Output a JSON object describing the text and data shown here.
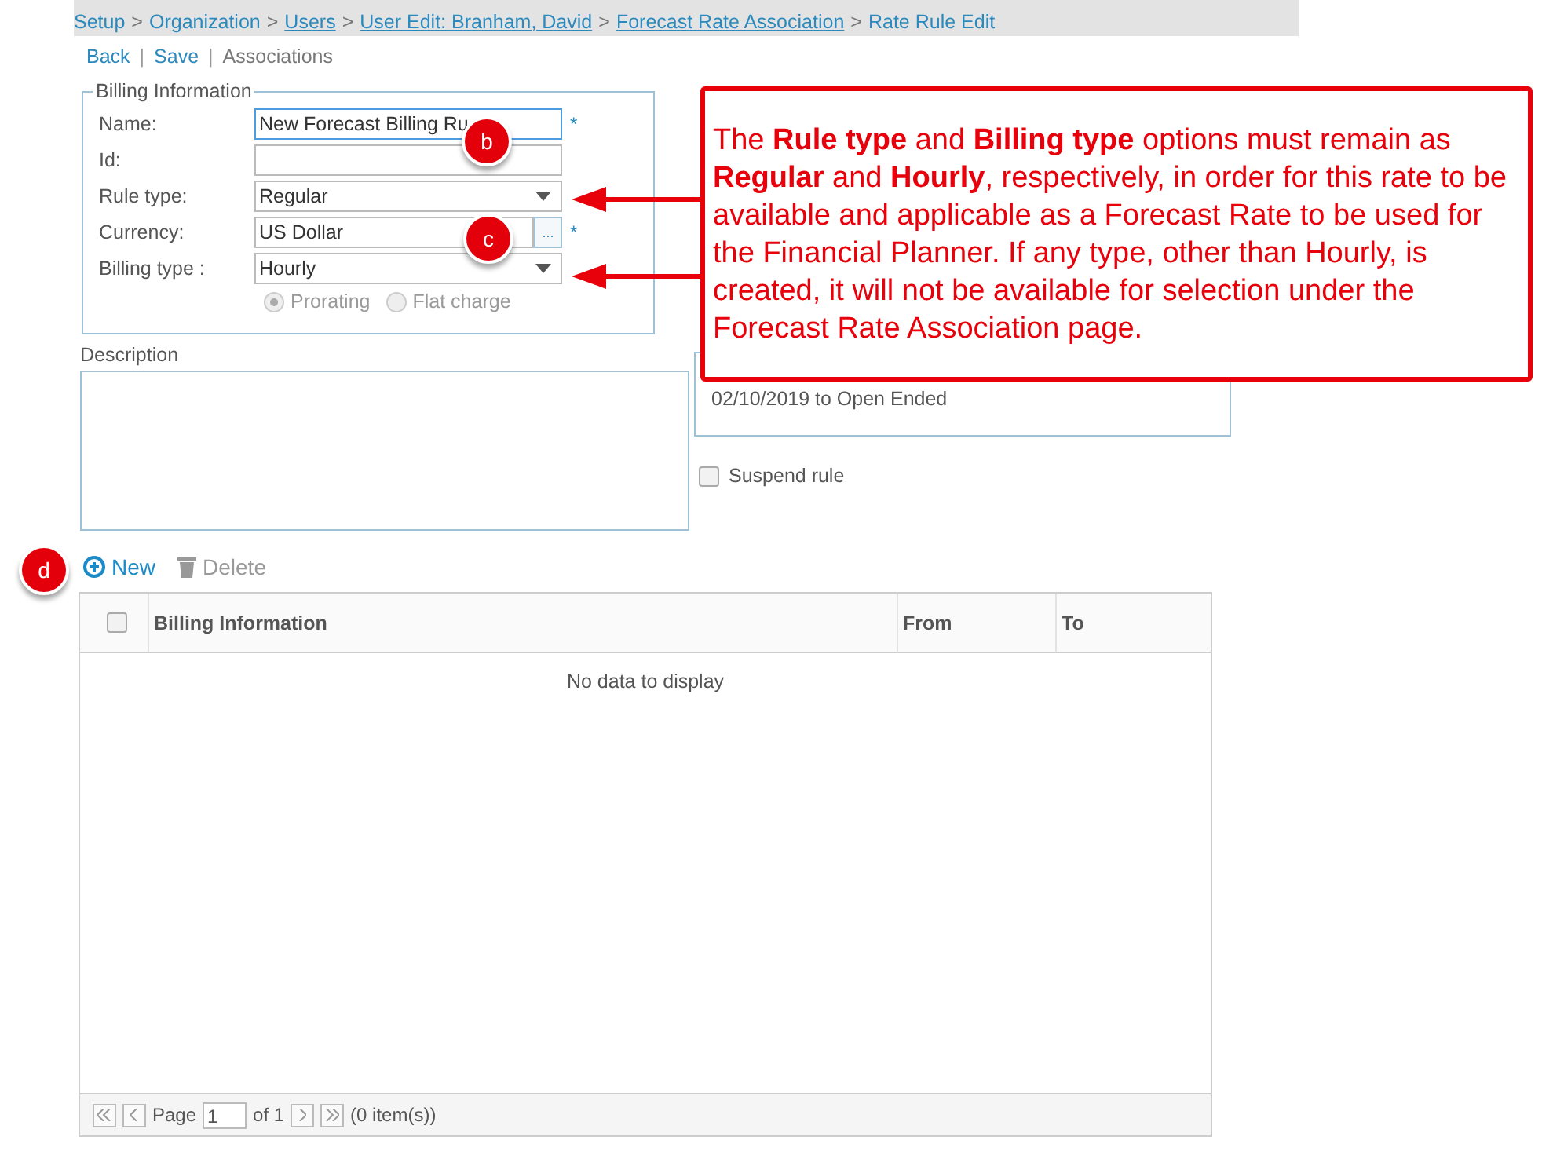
{
  "breadcrumb": [
    {
      "label": "Setup",
      "link": false
    },
    {
      "separator": ">",
      "label": "Organization",
      "link": false
    },
    {
      "separator": ">",
      "label": "Users",
      "link": true
    },
    {
      "separator": ">",
      "label": "User Edit: Branham, David",
      "link": true
    },
    {
      "separator": ">",
      "label": "Forecast Rate Association",
      "link": true
    },
    {
      "separator": ">",
      "label": "Rate Rule Edit",
      "link": false
    }
  ],
  "actions": [
    {
      "label": "Back",
      "disabled": false
    },
    {
      "separator": "|",
      "label": "Save",
      "disabled": false
    },
    {
      "separator": "|",
      "label": "Associations",
      "disabled": true
    }
  ],
  "billing_information": {
    "legend": "Billing Information",
    "fields": [
      {
        "kind": "text",
        "label": "Name:",
        "value": "New Forecast Billing Ru",
        "required_mark": "*"
      },
      {
        "kind": "text",
        "label": "Id:"
      },
      {
        "kind": "select",
        "label": "Rule type:",
        "value": "Regular"
      },
      {
        "kind": "lookup",
        "label": "Currency:",
        "value": "US Dollar",
        "button": "...",
        "required_mark": "*"
      },
      {
        "kind": "select",
        "label": "Billing type :",
        "value": "Hourly"
      }
    ],
    "options": [
      {
        "label": "Prorating",
        "selected": true,
        "disabled": true
      },
      {
        "label": "Flat charge",
        "selected": false,
        "disabled": true
      }
    ]
  },
  "description": {
    "label": "Description"
  },
  "date_span": {
    "value": "02/10/2019 to Open Ended"
  },
  "suspend_rule": {
    "label": "Suspend rule",
    "checked": false
  },
  "toolbar": [
    {
      "kind": "new",
      "label": "New",
      "disabled": false
    },
    {
      "kind": "delete",
      "label": "Delete",
      "disabled": true
    }
  ],
  "grid": {
    "columns": [
      "Billing Information",
      "From",
      "To"
    ],
    "empty_text": "No data to display",
    "all_checked": false,
    "pager": {
      "page_label": "Page",
      "page": "1",
      "of_label": "of 1",
      "items": "(0 item(s))"
    }
  },
  "callout": {
    "text": "The **Rule type** and **Billing type**  options must remain as **Regular** and **Hourly**, respectively, in order for this rate to be available and applicable as a Forecast Rate to be used for the Financial Planner. If any type, other than Hourly, is created, it will not be available for selection under the Forecast Rate Association page."
  },
  "badges": [
    {
      "label": "b"
    },
    {
      "label": "c"
    },
    {
      "label": "d"
    }
  ]
}
